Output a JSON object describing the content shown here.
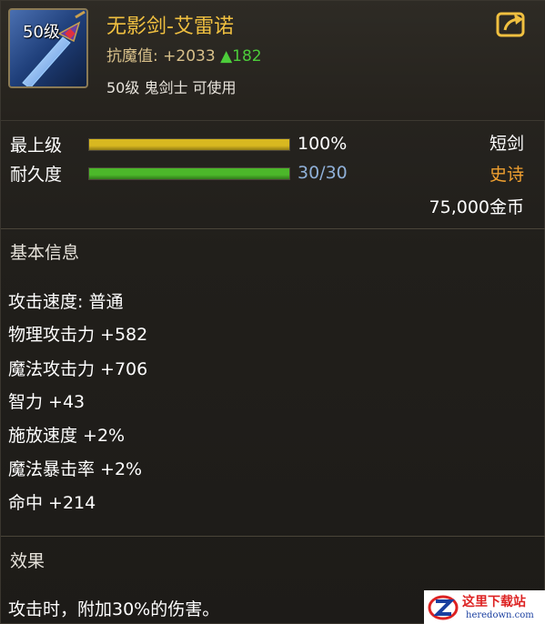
{
  "item": {
    "level_badge": "50级",
    "name": "无影剑-艾雷诺",
    "stat_key": "抗魔值:",
    "stat_value": "+2033",
    "stat_increase": "▲182",
    "requirement": "50级 鬼剑士 可使用"
  },
  "bars": [
    {
      "label": "最上级",
      "value_text": "100%",
      "fill": 1.0,
      "color": "#d8b820",
      "value_color": "#ffffff"
    },
    {
      "label": "耐久度",
      "value_text": "30/30",
      "fill": 1.0,
      "color": "#4cb82a",
      "value_color": "#8fb0d8"
    }
  ],
  "right_info": {
    "weapon_type": "短剑",
    "rarity": "史诗",
    "rarity_color": "#f0a030",
    "price": "75,000金币"
  },
  "basic_info": {
    "title": "基本信息",
    "attributes": [
      "攻击速度: 普通",
      "物理攻击力 +582",
      "魔法攻击力 +706",
      "智力 +43",
      "施放速度 +2%",
      "魔法暴击率 +2%",
      "命中 +214"
    ]
  },
  "effect": {
    "title": "效果",
    "text": "攻击时，附加30%的伤害。"
  },
  "watermark": {
    "name": "这里下载站",
    "url": "heredown.com"
  },
  "icons": [
    "item-sword-icon",
    "share-icon",
    "watermark-logo-icon"
  ]
}
